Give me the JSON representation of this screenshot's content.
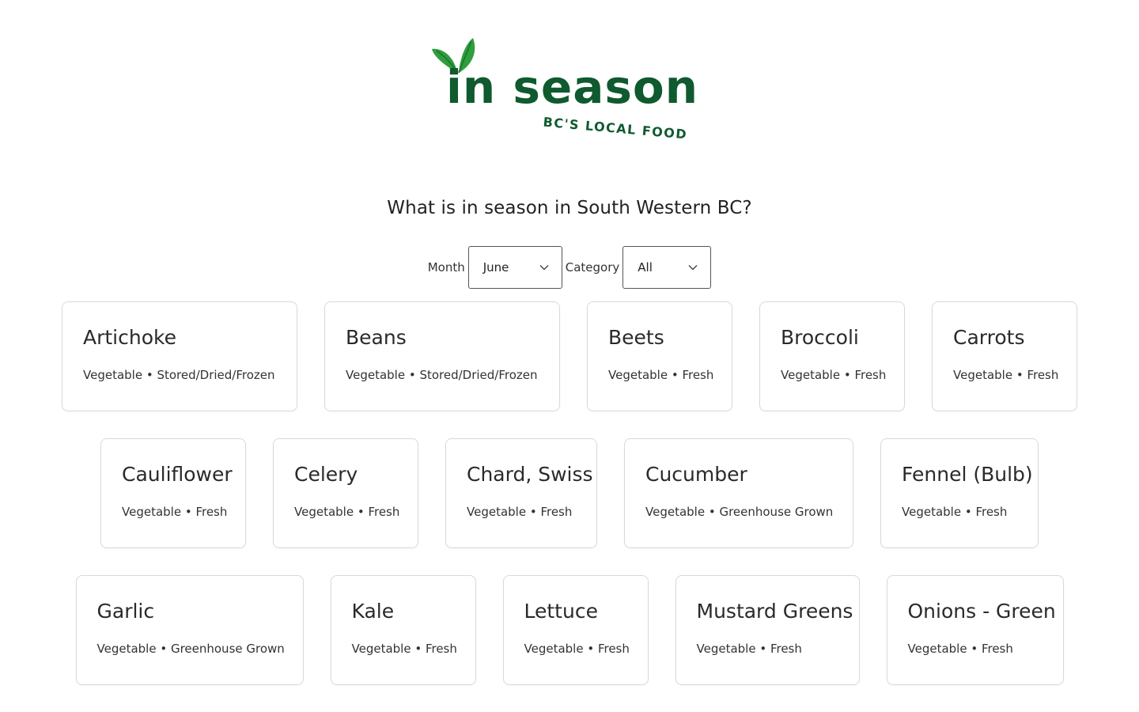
{
  "logo": {
    "word": "in season",
    "tagline": "BC'S LOCAL FOOD",
    "brand_color": "#0f5a2e",
    "leaf_color": "#2e9e3e"
  },
  "question": "What is in season in South Western BC?",
  "filters": {
    "month_label": "Month",
    "month_value": "June",
    "category_label": "Category",
    "category_value": "All"
  },
  "rows": [
    [
      {
        "name": "Artichoke",
        "meta": "Vegetable • Stored/Dried/Frozen"
      },
      {
        "name": "Beans",
        "meta": "Vegetable • Stored/Dried/Frozen"
      },
      {
        "name": "Beets",
        "meta": "Vegetable • Fresh"
      },
      {
        "name": "Broccoli",
        "meta": "Vegetable • Fresh"
      },
      {
        "name": "Carrots",
        "meta": "Vegetable • Fresh"
      }
    ],
    [
      {
        "name": "Cauliflower",
        "meta": "Vegetable • Fresh"
      },
      {
        "name": "Celery",
        "meta": "Vegetable • Fresh"
      },
      {
        "name": "Chard, Swiss",
        "meta": "Vegetable • Fresh"
      },
      {
        "name": "Cucumber",
        "meta": "Vegetable • Greenhouse Grown"
      },
      {
        "name": "Fennel (Bulb)",
        "meta": "Vegetable • Fresh"
      }
    ],
    [
      {
        "name": "Garlic",
        "meta": "Vegetable • Greenhouse Grown"
      },
      {
        "name": "Kale",
        "meta": "Vegetable • Fresh"
      },
      {
        "name": "Lettuce",
        "meta": "Vegetable • Fresh"
      },
      {
        "name": "Mustard Greens",
        "meta": "Vegetable • Fresh"
      },
      {
        "name": "Onions - Green",
        "meta": "Vegetable • Fresh"
      }
    ]
  ]
}
